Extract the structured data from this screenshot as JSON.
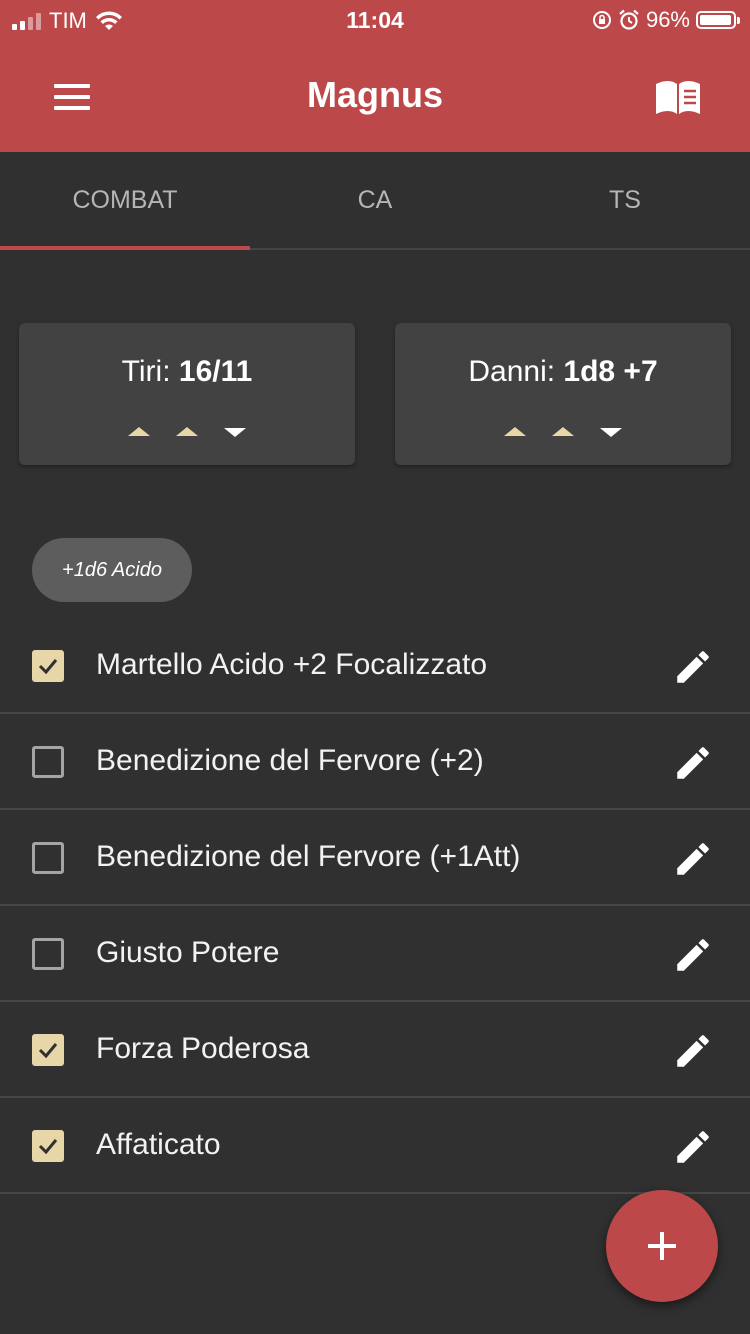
{
  "status_bar": {
    "carrier": "TIM",
    "time": "11:04",
    "battery": "96%"
  },
  "app_bar": {
    "title": "Magnus"
  },
  "tabs": [
    {
      "label": "COMBAT",
      "active": true
    },
    {
      "label": "CA",
      "active": false
    },
    {
      "label": "TS",
      "active": false
    }
  ],
  "cards": {
    "tiri": {
      "label": "Tiri:",
      "value": "16/11"
    },
    "danni": {
      "label": "Danni:",
      "value": "1d8 +7"
    }
  },
  "chip": {
    "label": "+1d6 Acido"
  },
  "modifiers": [
    {
      "label": "Martello Acido +2 Focalizzato",
      "checked": true
    },
    {
      "label": "Benedizione del Fervore (+2)",
      "checked": false
    },
    {
      "label": "Benedizione del Fervore (+1Att)",
      "checked": false
    },
    {
      "label": "Giusto Potere",
      "checked": false
    },
    {
      "label": "Forza Poderosa",
      "checked": true
    },
    {
      "label": "Affaticato",
      "checked": true
    }
  ],
  "colors": {
    "primary": "#bd484a",
    "background": "#303030",
    "card": "#424242",
    "accent": "#e6d6a8"
  },
  "icons": {
    "menu": "hamburger-icon",
    "book": "book-icon",
    "edit": "pencil-icon",
    "add": "plus-icon"
  }
}
